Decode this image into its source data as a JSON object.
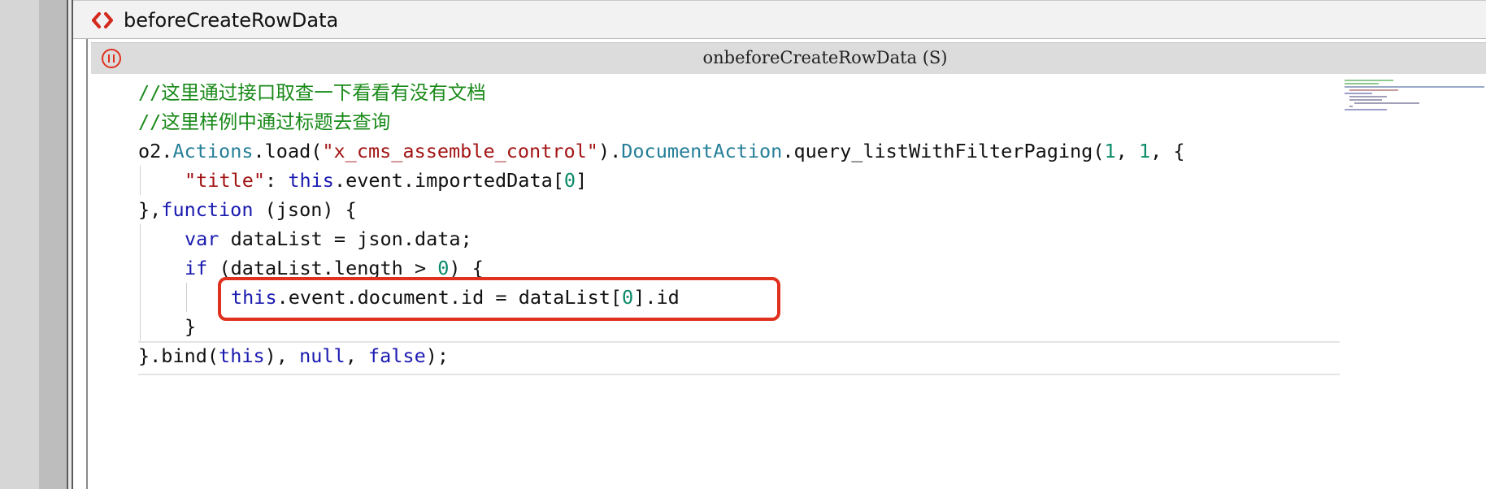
{
  "window": {
    "title": "beforeCreateRowData",
    "title_icon": "code-brackets-icon"
  },
  "editor": {
    "header_title": "onbeforeCreateRowData (S)",
    "header_icon": "info-icon"
  },
  "code": {
    "line1": "//这里通过接口取查一下看看有没有文档",
    "line2": "//这里样例中通过标题去查询",
    "line3_obj": "o2.",
    "line3_actions": "Actions",
    "line3_load": ".load(",
    "line3_str": "\"x_cms_assemble_control\"",
    "line3_close": ").",
    "line3_cls": "DocumentAction",
    "line3_method": ".query_listWithFilterPaging(",
    "line3_n1": "1",
    "line3_comma": ", ",
    "line3_n2": "1",
    "line3_rest": ", {",
    "line4_key": "\"title\"",
    "line4_colon": ": ",
    "line4_this": "this",
    "line4_rest": ".event.importedData[",
    "line4_n": "0",
    "line4_end": "]",
    "line5_open": "},",
    "line5_fn": "function",
    "line5_rest": " (json) {",
    "line6_var": "var",
    "line6_rest": " dataList = json.data;",
    "line7_if": "if",
    "line7_mid": " (dataList.length > ",
    "line7_n": "0",
    "line7_end": ") {",
    "line8_this": "this",
    "line8_mid": ".event.document.id = dataList[",
    "line8_n": "0",
    "line8_end": "].id",
    "line9": "}",
    "line10_open": "}.bind(",
    "line10_this": "this",
    "line10_sep1": "), ",
    "line10_null": "null",
    "line10_sep2": ", ",
    "line10_false": "false",
    "line10_end": ");"
  },
  "colors": {
    "comment": "#1a8a1a",
    "keyword": "#1a1ab0",
    "string": "#a31515",
    "number": "#0a8a6a",
    "highlight_box": "#e0301e"
  }
}
